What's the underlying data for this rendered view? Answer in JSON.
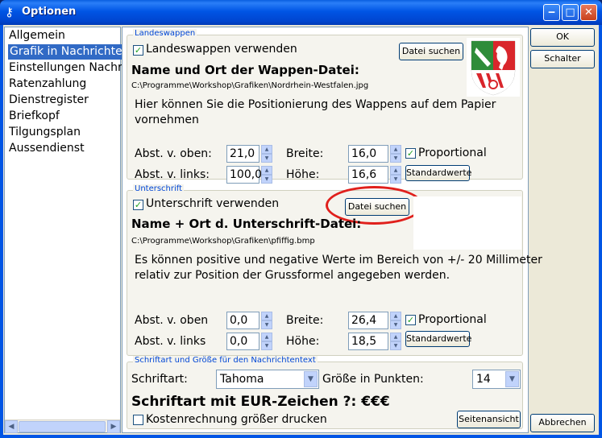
{
  "window": {
    "title": "Optionen",
    "title_icon": "key-icon"
  },
  "nav": {
    "items": [
      {
        "label": "Allgemein"
      },
      {
        "label": "Grafik in Nachrichten"
      },
      {
        "label": "Einstellungen Nachrichten"
      },
      {
        "label": "Ratenzahlung"
      },
      {
        "label": "Dienstregister"
      },
      {
        "label": "Briefkopf"
      },
      {
        "label": "Tilgungsplan"
      },
      {
        "label": "Aussendienst"
      }
    ],
    "selected": "Grafik in Nachrichten"
  },
  "landeswappen": {
    "group_label": "Landeswappen",
    "checkbox_label": "Landeswappen verwenden",
    "checked": true,
    "browse_label": "Datei suchen",
    "file_heading": "Name und Ort der Wappen-Datei:",
    "file_path": "C:\\Programme\\Workshop\\Grafiken\\Nordrhein-Westfalen.jpg",
    "hint": [
      "Hier können Sie die Positionierung des Wappens auf dem Papier",
      "vornehmen"
    ],
    "abst_oben_label": "Abst. v. oben:",
    "abst_oben_value": "21,0",
    "abst_links_label": "Abst. v. links:",
    "abst_links_value": "100,0",
    "breite_label": "Breite:",
    "breite_value": "16,0",
    "hoehe_label": "Höhe:",
    "hoehe_value": "16,6",
    "proportional_label": "Proportional",
    "proportional_checked": true,
    "standard_label": "Standardwerte"
  },
  "unterschrift": {
    "group_label": "Unterschrift",
    "checkbox_label": "Unterschrift verwenden",
    "checked": true,
    "browse_label": "Datei suchen",
    "file_heading": "Name + Ort d. Unterschrift-Datei:",
    "file_path": "C:\\Programme\\Workshop\\Grafiken\\pfiffig.bmp",
    "hint": [
      "Es können positive und negative Werte im Bereich von +/- 20 Millimeter",
      "relativ zur Position der Grussformel angegeben werden."
    ],
    "abst_oben_label": "Abst. v. oben",
    "abst_oben_value": "0,0",
    "abst_links_label": "Abst. v. links",
    "abst_links_value": "0,0",
    "breite_label": "Breite:",
    "breite_value": "26,4",
    "hoehe_label": "Höhe:",
    "hoehe_value": "18,5",
    "proportional_label": "Proportional",
    "proportional_checked": true,
    "standard_label": "Standardwerte"
  },
  "font": {
    "group_label": "Schriftart und Größe für den Nachrichtentext",
    "font_label": "Schriftart:",
    "font_value": "Tahoma",
    "size_label": "Größe in Punkten:",
    "size_value": "14",
    "sample_text": "Schriftart mit EUR-Zeichen ?: €€€",
    "large_print_label": "Kostenrechnung größer drucken",
    "large_print_checked": false,
    "preview_label": "Seitenansicht"
  },
  "buttons": {
    "ok": "OK",
    "schalter": "Schalter",
    "cancel": "Abbrechen"
  },
  "colors": {
    "selection": "#316ac5",
    "group_label": "#0046d5",
    "highlight_circle": "#e0201c"
  }
}
